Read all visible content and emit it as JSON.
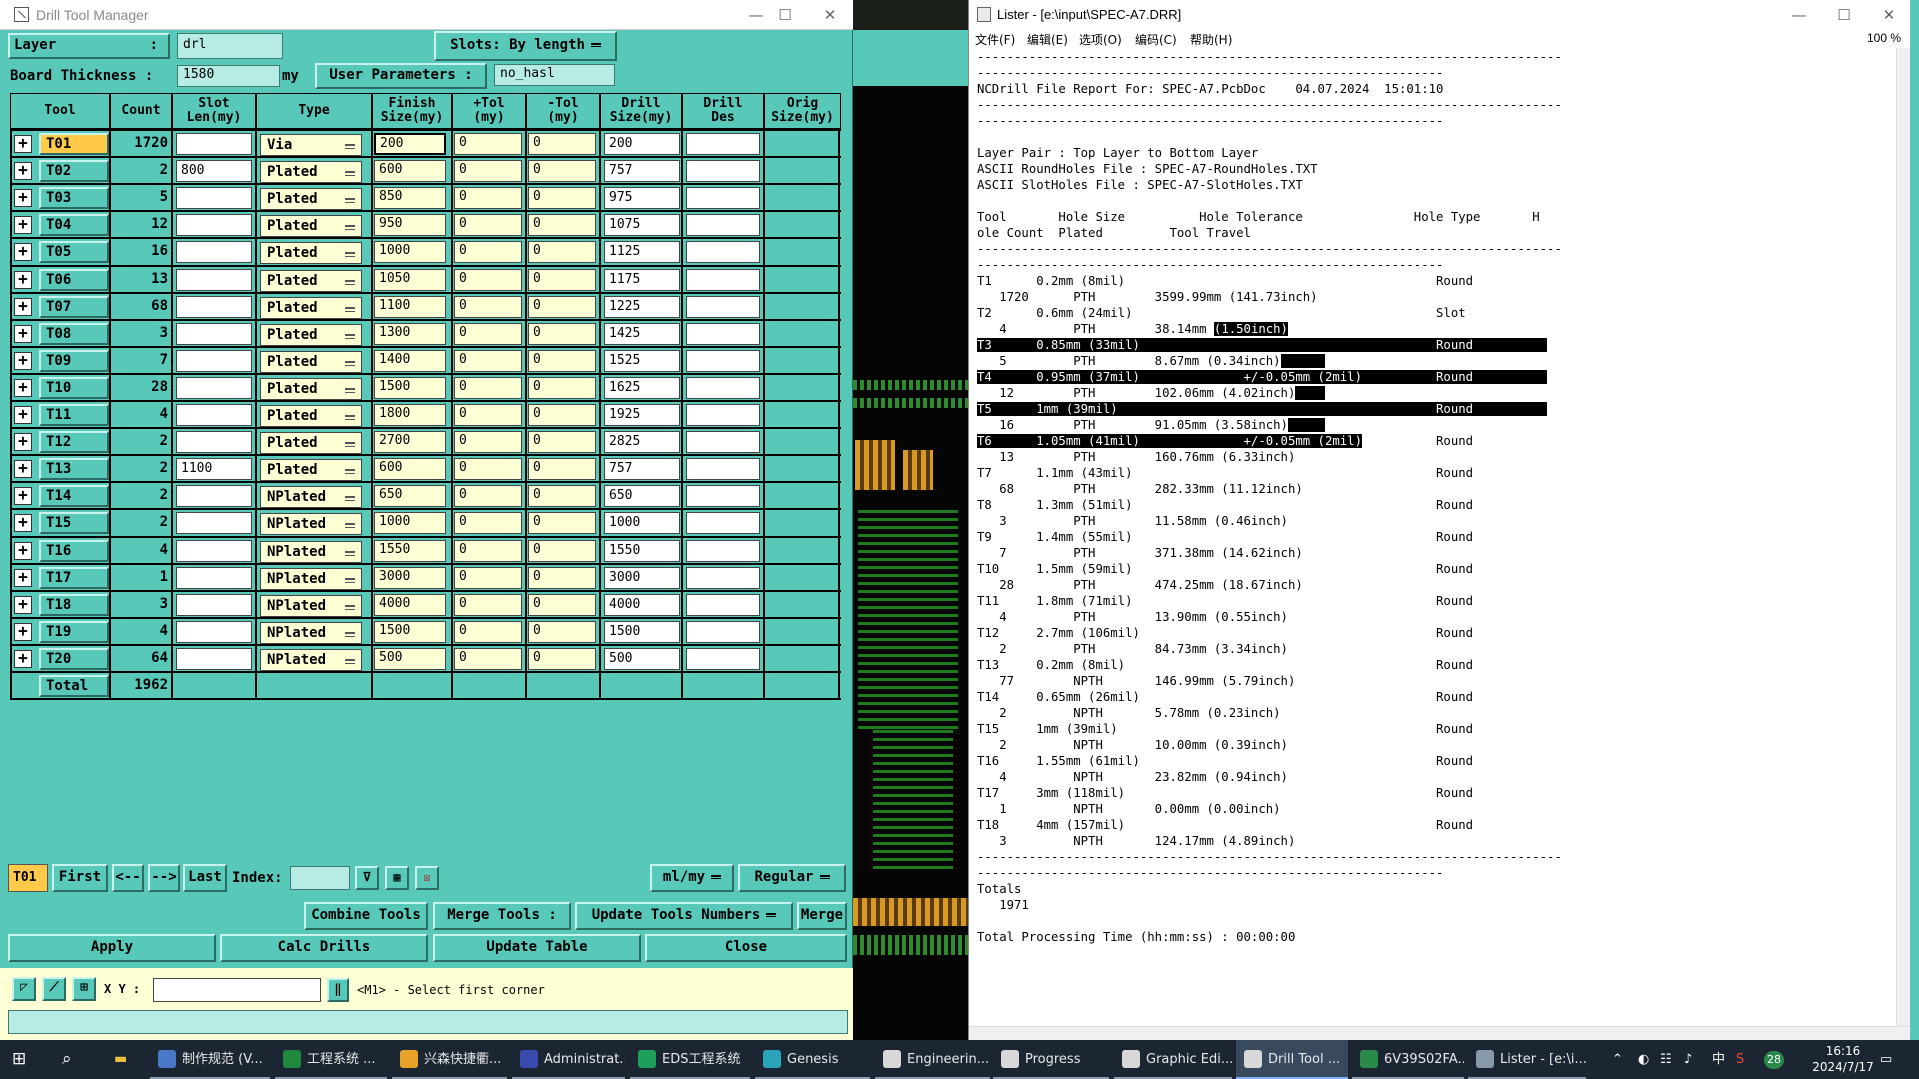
{
  "dtm": {
    "title": "Drill Tool Manager",
    "layer_label": "Layer",
    "layer_colon": ":",
    "layer_value": "drl",
    "slots_label": "Slots:",
    "slots_value": "By length",
    "board_thickness_label": "Board Thickness",
    "board_thickness_colon": ":",
    "board_thickness_value": "1580",
    "board_thickness_unit": "my",
    "user_params_label": "User Parameters",
    "user_params_colon": ":",
    "user_params_value": "no_hasl",
    "columns": [
      "Tool",
      "Count",
      "Slot\nLen(my)",
      "Type",
      "Finish\nSize(my)",
      "+Tol\n(my)",
      "-Tol\n(my)",
      "Drill\nSize(my)",
      "Drill\nDes",
      "Orig\nSize(my)"
    ],
    "rows": [
      {
        "tool": "T01",
        "count": "1720",
        "slot": "",
        "type": "Via",
        "finish": "200",
        "ptol": "0",
        "ntol": "0",
        "drill": "200"
      },
      {
        "tool": "T02",
        "count": "2",
        "slot": "800",
        "type": "Plated",
        "finish": "600",
        "ptol": "0",
        "ntol": "0",
        "drill": "757"
      },
      {
        "tool": "T03",
        "count": "5",
        "slot": "",
        "type": "Plated",
        "finish": "850",
        "ptol": "0",
        "ntol": "0",
        "drill": "975"
      },
      {
        "tool": "T04",
        "count": "12",
        "slot": "",
        "type": "Plated",
        "finish": "950",
        "ptol": "0",
        "ntol": "0",
        "drill": "1075"
      },
      {
        "tool": "T05",
        "count": "16",
        "slot": "",
        "type": "Plated",
        "finish": "1000",
        "ptol": "0",
        "ntol": "0",
        "drill": "1125"
      },
      {
        "tool": "T06",
        "count": "13",
        "slot": "",
        "type": "Plated",
        "finish": "1050",
        "ptol": "0",
        "ntol": "0",
        "drill": "1175"
      },
      {
        "tool": "T07",
        "count": "68",
        "slot": "",
        "type": "Plated",
        "finish": "1100",
        "ptol": "0",
        "ntol": "0",
        "drill": "1225"
      },
      {
        "tool": "T08",
        "count": "3",
        "slot": "",
        "type": "Plated",
        "finish": "1300",
        "ptol": "0",
        "ntol": "0",
        "drill": "1425"
      },
      {
        "tool": "T09",
        "count": "7",
        "slot": "",
        "type": "Plated",
        "finish": "1400",
        "ptol": "0",
        "ntol": "0",
        "drill": "1525"
      },
      {
        "tool": "T10",
        "count": "28",
        "slot": "",
        "type": "Plated",
        "finish": "1500",
        "ptol": "0",
        "ntol": "0",
        "drill": "1625"
      },
      {
        "tool": "T11",
        "count": "4",
        "slot": "",
        "type": "Plated",
        "finish": "1800",
        "ptol": "0",
        "ntol": "0",
        "drill": "1925"
      },
      {
        "tool": "T12",
        "count": "2",
        "slot": "",
        "type": "Plated",
        "finish": "2700",
        "ptol": "0",
        "ntol": "0",
        "drill": "2825"
      },
      {
        "tool": "T13",
        "count": "2",
        "slot": "1100",
        "type": "Plated",
        "finish": "600",
        "ptol": "0",
        "ntol": "0",
        "drill": "757"
      },
      {
        "tool": "T14",
        "count": "2",
        "slot": "",
        "type": "NPlated",
        "finish": "650",
        "ptol": "0",
        "ntol": "0",
        "drill": "650"
      },
      {
        "tool": "T15",
        "count": "2",
        "slot": "",
        "type": "NPlated",
        "finish": "1000",
        "ptol": "0",
        "ntol": "0",
        "drill": "1000"
      },
      {
        "tool": "T16",
        "count": "4",
        "slot": "",
        "type": "NPlated",
        "finish": "1550",
        "ptol": "0",
        "ntol": "0",
        "drill": "1550"
      },
      {
        "tool": "T17",
        "count": "1",
        "slot": "",
        "type": "NPlated",
        "finish": "3000",
        "ptol": "0",
        "ntol": "0",
        "drill": "3000"
      },
      {
        "tool": "T18",
        "count": "3",
        "slot": "",
        "type": "NPlated",
        "finish": "4000",
        "ptol": "0",
        "ntol": "0",
        "drill": "4000"
      },
      {
        "tool": "T19",
        "count": "4",
        "slot": "",
        "type": "NPlated",
        "finish": "1500",
        "ptol": "0",
        "ntol": "0",
        "drill": "1500"
      },
      {
        "tool": "T20",
        "count": "64",
        "slot": "",
        "type": "NPlated",
        "finish": "500",
        "ptol": "0",
        "ntol": "0",
        "drill": "500"
      }
    ],
    "total_label": "Total",
    "total_count": "1962",
    "nav": {
      "current": "T01",
      "first": "First",
      "prev": "<--",
      "next": "-->",
      "last": "Last",
      "index_label": "Index:",
      "units": "ml/my",
      "mode": "Regular"
    },
    "actions": {
      "combine": "Combine Tools",
      "merge_label": "Merge Tools :",
      "update_numbers": "Update Tools Numbers",
      "merge": "Merge"
    },
    "bottom": {
      "apply": "Apply",
      "calc": "Calc Drills",
      "update": "Update Table",
      "close": "Close"
    },
    "status": {
      "xy_label": "X Y :",
      "message": "<M1> - Select first corner"
    }
  },
  "lister": {
    "title": "Lister - [e:\\input\\SPEC-A7.DRR]",
    "menu": [
      "文件(F)",
      "编辑(E)",
      "选项(O)",
      "编码(C)",
      "帮助(H)"
    ],
    "zoom": "100 %",
    "lines": [
      {
        "t": "-------------------------------------------------------------------------------"
      },
      {
        "t": "---------------------------------------------------------------"
      },
      {
        "t": "NCDrill File Report For: SPEC-A7.PcbDoc    04.07.2024  15:01:10"
      },
      {
        "t": "-------------------------------------------------------------------------------"
      },
      {
        "t": "---------------------------------------------------------------"
      },
      {
        "t": ""
      },
      {
        "t": "Layer Pair : Top Layer to Bottom Layer"
      },
      {
        "t": "ASCII RoundHoles File : SPEC-A7-RoundHoles.TXT"
      },
      {
        "t": "ASCII SlotHoles File : SPEC-A7-SlotHoles.TXT"
      },
      {
        "t": ""
      },
      {
        "t": "Tool       Hole Size          Hole Tolerance               Hole Type       H"
      },
      {
        "t": "ole Count  Plated         Tool Travel"
      },
      {
        "t": "-------------------------------------------------------------------------------"
      },
      {
        "t": "---------------------------------------------------------------"
      },
      {
        "t": "T1      0.2mm (8mil)                                          Round"
      },
      {
        "t": "   1720      PTH        3599.99mm (141.73inch)"
      },
      {
        "t": "T2      0.6mm (24mil)                                         Slot"
      },
      {
        "t": "   4         PTH        38.14mm ",
        "h": "(1.50inch)"
      },
      {
        "t": "",
        "h": "T3      0.85mm (33mil)                                        Round          "
      },
      {
        "t": "   5         PTH        8.67mm (0.34inch)",
        "h": "      "
      },
      {
        "t": "",
        "h": "T4      0.95mm (37mil)              +/-0.05mm (2mil)          Round          "
      },
      {
        "t": "   12        PTH        102.06mm (4.02inch)",
        "h": "    "
      },
      {
        "t": "",
        "h": "T5      1mm (39mil)                                           Round          "
      },
      {
        "t": "   16        PTH        91.05mm (3.58inch)",
        "h": "     "
      },
      {
        "t": "",
        "h": "T6      1.05mm (41mil)              +/-0.05mm (2mil)",
        "t2": "          Round"
      },
      {
        "t": "   13        PTH        160.76mm (6.33inch)"
      },
      {
        "t": "T7      1.1mm (43mil)                                         Round"
      },
      {
        "t": "   68        PTH        282.33mm (11.12inch)"
      },
      {
        "t": "T8      1.3mm (51mil)                                         Round"
      },
      {
        "t": "   3         PTH        11.58mm (0.46inch)"
      },
      {
        "t": "T9      1.4mm (55mil)                                         Round"
      },
      {
        "t": "   7         PTH        371.38mm (14.62inch)"
      },
      {
        "t": "T10     1.5mm (59mil)                                         Round"
      },
      {
        "t": "   28        PTH        474.25mm (18.67inch)"
      },
      {
        "t": "T11     1.8mm (71mil)                                         Round"
      },
      {
        "t": "   4         PTH        13.90mm (0.55inch)"
      },
      {
        "t": "T12     2.7mm (106mil)                                        Round"
      },
      {
        "t": "   2         PTH        84.73mm (3.34inch)"
      },
      {
        "t": "T13     0.2mm (8mil)                                          Round"
      },
      {
        "t": "   77        NPTH       146.99mm (5.79inch)"
      },
      {
        "t": "T14     0.65mm (26mil)                                        Round"
      },
      {
        "t": "   2         NPTH       5.78mm (0.23inch)"
      },
      {
        "t": "T15     1mm (39mil)                                           Round"
      },
      {
        "t": "   2         NPTH       10.00mm (0.39inch)"
      },
      {
        "t": "T16     1.55mm (61mil)                                        Round"
      },
      {
        "t": "   4         NPTH       23.82mm (0.94inch)"
      },
      {
        "t": "T17     3mm (118mil)                                          Round"
      },
      {
        "t": "   1         NPTH       0.00mm (0.00inch)"
      },
      {
        "t": "T18     4mm (157mil)                                          Round"
      },
      {
        "t": "   3         NPTH       124.17mm (4.89inch)"
      },
      {
        "t": "-------------------------------------------------------------------------------"
      },
      {
        "t": "---------------------------------------------------------------"
      },
      {
        "t": "Totals"
      },
      {
        "t": "   1971"
      },
      {
        "t": ""
      },
      {
        "t": "Total Processing Time (hh:mm:ss) : 00:00:00"
      }
    ]
  },
  "taskbar": {
    "items": [
      {
        "label": "制作规范 (V...",
        "color": "#4a78c8"
      },
      {
        "label": "工程系统 ...",
        "color": "#1f8a3b"
      },
      {
        "label": "兴森快捷衢...",
        "color": "#e8a22a"
      },
      {
        "label": "Administrat...",
        "color": "#3a4bb0"
      },
      {
        "label": "EDS工程系统",
        "color": "#1fa05a"
      },
      {
        "label": "Genesis",
        "color": "#2aa4b8"
      },
      {
        "label": "Engineerin...",
        "color": "#d8d8d8"
      },
      {
        "label": "Progress",
        "color": "#d8d8d8"
      },
      {
        "label": "Graphic Edi...",
        "color": "#d8d8d8"
      },
      {
        "label": "Drill Tool ...",
        "color": "#d8d8d8"
      },
      {
        "label": "6V39S02FA...",
        "color": "#2a8a4a"
      },
      {
        "label": "Lister - [e:\\i...",
        "color": "#8899aa"
      }
    ],
    "ime": "中",
    "badge": "28",
    "time": "16:16",
    "date": "2024/7/17"
  }
}
